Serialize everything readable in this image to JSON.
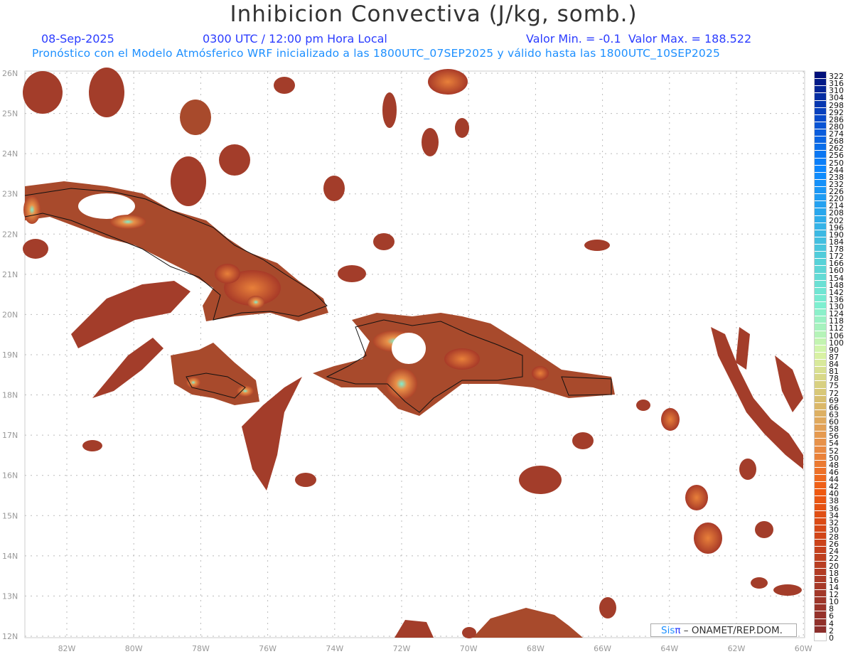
{
  "header": {
    "title": "Inhibicion Convectiva (J/kg, somb.)",
    "date": "08-Sep-2025",
    "time": "0300 UTC / 12:00 pm Hora Local",
    "min_max": "Valor Min. = -0.1  Valor Max. = 188.522",
    "subtitle": "Pronóstico con el Modelo Atmósferico WRF inicializado a las 1800UTC_07SEP2025 y válido hasta las  1800UTC_10SEP2025"
  },
  "axes": {
    "lat_labels": [
      "26N",
      "25N",
      "24N",
      "23N",
      "22N",
      "21N",
      "20N",
      "19N",
      "18N",
      "17N",
      "16N",
      "15N",
      "14N",
      "13N",
      "12N"
    ],
    "lon_labels": [
      "82W",
      "80W",
      "78W",
      "76W",
      "74W",
      "72W",
      "70W",
      "68W",
      "66W",
      "64W",
      "62W",
      "60W"
    ]
  },
  "colorbar": {
    "labels": [
      "322",
      "316",
      "310",
      "304",
      "298",
      "292",
      "286",
      "280",
      "274",
      "268",
      "262",
      "256",
      "250",
      "244",
      "238",
      "232",
      "226",
      "220",
      "214",
      "208",
      "202",
      "196",
      "190",
      "184",
      "178",
      "172",
      "166",
      "160",
      "154",
      "148",
      "142",
      "136",
      "130",
      "124",
      "118",
      "112",
      "106",
      "100",
      "90",
      "87",
      "84",
      "81",
      "78",
      "75",
      "72",
      "69",
      "66",
      "63",
      "60",
      "58",
      "56",
      "54",
      "52",
      "50",
      "48",
      "46",
      "44",
      "42",
      "40",
      "38",
      "36",
      "34",
      "32",
      "30",
      "28",
      "26",
      "24",
      "22",
      "20",
      "18",
      "16",
      "14",
      "12",
      "10",
      "8",
      "6",
      "4",
      "2",
      "0"
    ],
    "color_stops": [
      "#00107a",
      "#0a4fd0",
      "#0a86ff",
      "#2aa8ec",
      "#55d0d8",
      "#7fefd0",
      "#d8f5a8",
      "#d8c070",
      "#e89048",
      "#f05a10",
      "#d04418",
      "#a83a28",
      "#8c2f2c",
      "#ffffff"
    ]
  },
  "credit": {
    "sis": "Sis",
    "pi": "π",
    "org": " –  ONAMET/REP.DOM."
  }
}
